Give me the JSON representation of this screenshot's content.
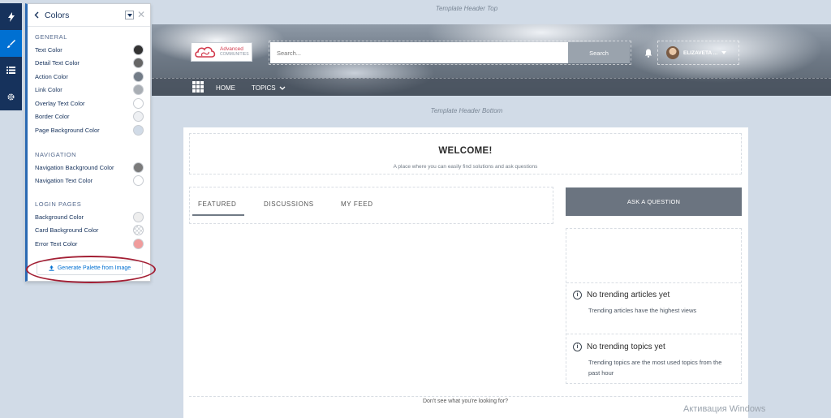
{
  "rail": {
    "items": [
      "lightning-icon",
      "brush-icon",
      "list-icon",
      "gear-icon"
    ]
  },
  "panel": {
    "title": "Colors",
    "sections": [
      {
        "heading": "GENERAL",
        "items": [
          {
            "label": "Text Color",
            "color": "#333333"
          },
          {
            "label": "Detail Text Color",
            "color": "#666666"
          },
          {
            "label": "Action Color",
            "color": "#737c87"
          },
          {
            "label": "Link Color",
            "color": "#a9aeb4"
          },
          {
            "label": "Overlay Text Color",
            "color": "#ffffff"
          },
          {
            "label": "Border Color",
            "color": "#eef0f3"
          },
          {
            "label": "Page Background Color",
            "color": "#d1dbe7"
          }
        ]
      },
      {
        "heading": "NAVIGATION",
        "items": [
          {
            "label": "Navigation Background Color",
            "color": "#7b7b7b"
          },
          {
            "label": "Navigation Text Color",
            "color": "#ffffff"
          }
        ]
      },
      {
        "heading": "LOGIN PAGES",
        "items": [
          {
            "label": "Background Color",
            "color": "#eeeeee"
          },
          {
            "label": "Card Background Color",
            "color": "checker"
          },
          {
            "label": "Error Text Color",
            "color": "#f09c9c"
          }
        ]
      }
    ],
    "generate_label": "Generate Palette from Image"
  },
  "page": {
    "header_top_label": "Template Header Top",
    "header_bottom_label": "Template Header Bottom",
    "logo": {
      "line1": "Advanced",
      "line2": "COMMUNITIES"
    },
    "search": {
      "placeholder": "Search...",
      "button": "Search"
    },
    "user": {
      "name": "ELIZAVETA ..."
    },
    "nav": {
      "home": "HOME",
      "topics": "TOPICS"
    },
    "welcome": {
      "title": "WELCOME!",
      "subtitle": "A place where you can easily find solutions and ask questions"
    },
    "tabs": [
      "FEATURED",
      "DISCUSSIONS",
      "MY FEED"
    ],
    "ask_button": "ASK A QUESTION",
    "trending": [
      {
        "title": "No trending articles yet",
        "desc": "Trending articles have the highest views"
      },
      {
        "title": "No trending topics yet",
        "desc": "Trending topics are the most used topics from the past hour"
      }
    ],
    "bottom_text": "Don't see what you're looking for?"
  },
  "watermark": "Активация Windows"
}
